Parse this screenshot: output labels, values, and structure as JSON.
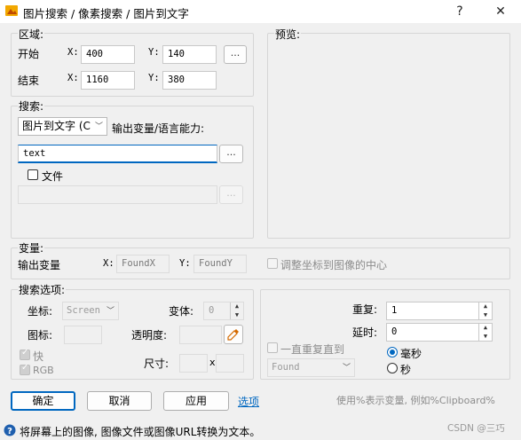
{
  "window": {
    "title": "图片搜索 / 像素搜索 / 图片到文字",
    "help_label": "?",
    "close_label": "✕"
  },
  "region": {
    "legend": "区域:",
    "start_label": "开始",
    "end_label": "结束",
    "x_label": "X:",
    "y_label": "Y:",
    "start_x": "400",
    "start_y": "140",
    "end_x": "1160",
    "end_y": "380",
    "pick_label": "..."
  },
  "preview": {
    "legend": "预览:"
  },
  "search": {
    "legend": "搜索:",
    "mode_value": "图片到文字 (C",
    "output_label": "输出变量/语言能力:",
    "text_value": "text",
    "text_more_label": "...",
    "file_label": "文件",
    "file_path_value": "",
    "file_browse_label": "..."
  },
  "variables": {
    "legend": "变量:",
    "output_label": "输出变量",
    "x_label": "X:",
    "y_label": "Y:",
    "found_x": "FoundX",
    "found_y": "FoundY",
    "center_label": "调整坐标到图像的中心"
  },
  "options": {
    "legend": "搜索选项:",
    "coords_label": "坐标:",
    "coords_value": "Screen",
    "variant_label": "变体:",
    "variant_value": "0",
    "icon_label": "图标:",
    "transparency_label": "透明度:",
    "fast_label": "快",
    "rgb_label": "RGB",
    "size_label": "尺寸:",
    "size_sep": "x",
    "repeat_label": "重复:",
    "repeat_value": "1",
    "delay_label": "延时:",
    "delay_value": "0",
    "repeat_until_label": "一直重复直到",
    "until_value": "Found",
    "ms_label": "毫秒",
    "sec_label": "秒"
  },
  "buttons": {
    "ok": "确定",
    "cancel": "取消",
    "apply": "应用",
    "options": "选项",
    "hint": "使用%表示变量, 例如%Clipboard%"
  },
  "status": {
    "text": "将屏幕上的图像, 图像文件或图像URL转换为文本。",
    "watermark": "CSDN @三巧"
  },
  "colors": {
    "accent": "#0067c0",
    "app_icon": "#f2a800"
  }
}
